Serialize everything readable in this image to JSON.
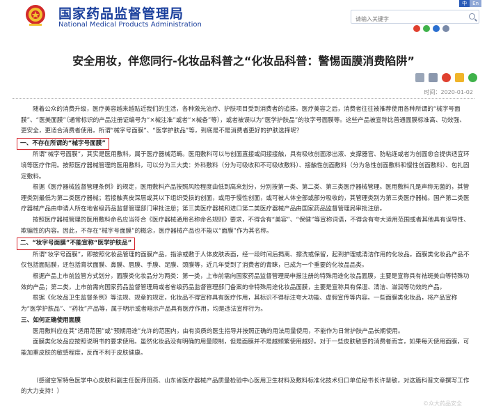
{
  "header": {
    "site_cn": "国家药品监督管理局",
    "site_en": "National Medical Products Administration",
    "lang": [
      "中",
      "En"
    ],
    "search_placeholder": "请输入关键字"
  },
  "article": {
    "title": "安全用妆，伴您同行-化妆品科普之“化妆品科普：警惕面膜消费陷阱”",
    "date": "时间：2020-01-02",
    "paragraphs": [
      "随着公众的消费升级，医疗美容越来越贴近我们的生活，各种激光治疗、护肤项目受到消费者的追捧。医疗美容之后，消费者往往被推荐使用各种所谓的“械字号面膜”、“医美面膜”（通常标识的产品注册证编号为“×械注准”或者“×械备”等），或者被误以为“医学护肤品”的妆字号面膜等。这些产品被宣称比普通面膜标准高、功效强、更安全，更适合消费者使用。所谓“械字号面膜”、“医学护肤品”等，到底是不是消费者更好的护肤选择呢？",
      "一、不存在所谓的“械字号面膜”",
      "所谓“械字号面膜”，其实是医用敷料，属于医疗器械范畴。医用敷料可以与创面直接或间接接触，具有吸收创面渗出液、支撑器官、防粘连或者为创面愈合提供适宜环境等医疗作用。按照医疗器械管理的医用敷料，可以分为三大类：外科敷料（分为可吸收和不可吸收敷料）、接触性创面敷料（分为急性创面敷料和慢性创面敷料）、包扎固定敷料。",
      "根据《医疗器械监督管理条例》的规定，医用敷料产品按照风险程度由低到高来划分，分别按第一类、第二类、第三类医疗器械管理。医用敷料凡是声称无菌的，其管理类别最低为第二类医疗器械；若接触真皮深层或其以下组织受损的创面，或用于慢性创面，或可被人体全部或部分吸收的，其管理类别为第三类医疗器械。国产第二类医疗器械产品由申请人所在地省级药品监督管理部门审批注册；第三类医疗器械和进口第二类医疗器械产品由国家药品监督管理局审批注册。",
      "按照医疗器械管理的医用敷料命名应当符合《医疗器械通用名称命名规则》要求，不得含有“美容”、“保健”等宣称词语，不得含有夸大适用范围或者其他具有误导性、欺骗性的内容。因此，不存在“械字号面膜”的概念，医疗器械产品也不能以“面膜”作为其名称。",
      "二、“妆字号面膜”不能宣称“医学护肤品”",
      "所谓“妆字号面膜”，即按照化妆品管理的面膜产品，指涂或敷于人体皮肤表面，经一段时间后揭离、擦洗或保留，起到护理或清洁作用的化妆品。面膜类化妆品产品不仅包括面贴膜，还包括膏状面膜、鼻膜、唇膜、手膜、足膜、颈膜等，近几年受到了消费者的青睐，已成为一个重要的化妆品品类。",
      "根据产品上市前监管方式划分，面膜类化妆品分为两类：第一类，上市前需向国家药品监督管理局申报注册的特殊用途化妆品面膜，主要是宣称具有祛斑美白等特殊功效的产品；第二类，上市前需向国家药品监督管理局或者省级药品监督管理部门备案的非特殊用途化妆品面膜，主要是宣称具有保湿、清洁、滋润等功效的产品。",
      "根据《化妆品卫生监督条例》等法规、规章的规定，化妆品不得宣称具有医疗作用，其标识不得标注夸大功能、虚假宣传等内容。一些面膜类化妆品，将产品宣称为“医学护肤品”、“药妆”产品等，属于明示或者暗示产品具有医疗作用，均是违法宣称行为。",
      "三、如何正确使用面膜",
      "医用敷料应在其“适用范围”或“预期用途”允许的范围内，由有资质的医生指导并按照正确的用法用量使用，不能作为日常护肤产品长期使用。",
      "面膜类化妆品应按照说明书的要求使用。虽然化妆品没有明确的用量限制，但是面膜并不是越频繁使用越好。对于一些皮肤敏感的消费者而言，如果每天使用面膜，可能加重皮肤的敏感程度，反而不利于皮肤健康。",
      "（感谢空军特色医学中心皮肤科副主任医师田燕、山东省医疗器械产品质量检验中心医用卫生材料及敷料标准化技术归口单位秘书长许慧敏，对这篇科普文章撰写工作的大力支持！）"
    ]
  },
  "watermark": "©众大药品安全",
  "colors": {
    "brand": "#1a3f9c",
    "highlight_box": "#d6232b"
  },
  "icons": [
    "national-emblem-icon",
    "search-icon",
    "weibo-icon",
    "wechat-icon",
    "favorite-icon",
    "print-icon",
    "download-icon"
  ]
}
